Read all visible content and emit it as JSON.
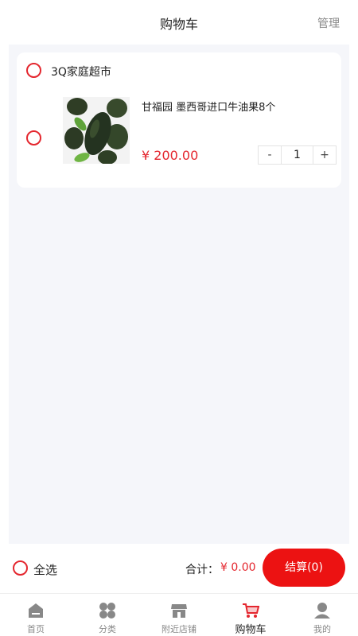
{
  "header": {
    "title": "购物车",
    "manage_label": "管理"
  },
  "shop": {
    "name": "3Q家庭超市",
    "items": [
      {
        "title": "甘福园 墨西哥进口牛油果8个",
        "price": "¥ 200.00",
        "quantity": "1",
        "minus": "-",
        "plus": "+"
      }
    ]
  },
  "checkout": {
    "select_all_label": "全选",
    "total_label": "合计：",
    "total_value": "¥ 0.00",
    "button_label": "结算(0)"
  },
  "tabbar": {
    "tabs": [
      {
        "label": "首页",
        "icon": "home-icon"
      },
      {
        "label": "分类",
        "icon": "category-icon"
      },
      {
        "label": "附近店铺",
        "icon": "store-icon"
      },
      {
        "label": "购物车",
        "icon": "cart-icon",
        "active": true
      },
      {
        "label": "我的",
        "icon": "user-icon"
      }
    ]
  },
  "colors": {
    "accent": "#e4262e",
    "button": "#ec1212",
    "background": "#f5f6fa"
  }
}
